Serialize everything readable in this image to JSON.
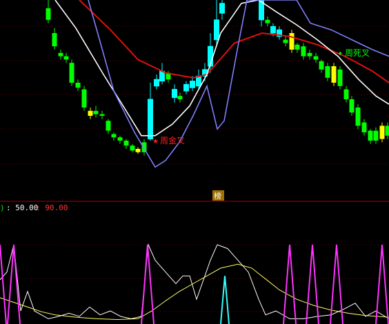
{
  "colors": {
    "background": "#000000",
    "grid": "#7a0000",
    "up_candle": "#00ffff",
    "down_candle": "#00ff00",
    "highlight_candle": "#ffff00",
    "ma_red": "#e01010",
    "ma_white": "#ffffff",
    "ma_blue": "#8080ff",
    "osc_white": "#ffffff",
    "osc_yellow": "#ffff66",
    "osc_magenta": "#ff33ff",
    "osc_cyan": "#33ffff",
    "label_value_a": "#ffffff",
    "label_value_b": "#ff3333",
    "golden_cross": "#ff2020",
    "death_cross": "#00ff00",
    "badge_bg": "#a07000"
  },
  "indicator_header": {
    "prefix": ")",
    "value_a": ": 50.00",
    "value_b": ": 90.00"
  },
  "divider_badge": "榜",
  "chart_data": [
    {
      "type": "candlestick",
      "ylim": [
        0,
        100
      ],
      "candles": [
        {
          "x": 70,
          "o": 95,
          "c": 88,
          "h": 100,
          "l": 86,
          "kind": "down"
        },
        {
          "x": 79,
          "o": 80,
          "c": 72,
          "h": 83,
          "l": 70,
          "kind": "down"
        },
        {
          "x": 88,
          "o": 68,
          "c": 66,
          "h": 70,
          "l": 64,
          "kind": "down"
        },
        {
          "x": 96,
          "o": 66,
          "c": 64,
          "h": 68,
          "l": 62,
          "kind": "down"
        },
        {
          "x": 104,
          "o": 62,
          "c": 50,
          "h": 64,
          "l": 48,
          "kind": "down"
        },
        {
          "x": 113,
          "o": 50,
          "c": 47,
          "h": 52,
          "l": 45,
          "kind": "down"
        },
        {
          "x": 122,
          "o": 46,
          "c": 35,
          "h": 48,
          "l": 33,
          "kind": "down"
        },
        {
          "x": 131,
          "o": 33,
          "c": 30,
          "h": 35,
          "l": 28,
          "kind": "highlight"
        },
        {
          "x": 139,
          "o": 33,
          "c": 31,
          "h": 36,
          "l": 29,
          "kind": "down"
        },
        {
          "x": 148,
          "o": 31,
          "c": 30,
          "h": 33,
          "l": 28,
          "kind": "down"
        },
        {
          "x": 157,
          "o": 27,
          "c": 21,
          "h": 28,
          "l": 19,
          "kind": "down"
        },
        {
          "x": 165,
          "o": 19,
          "c": 17,
          "h": 20,
          "l": 15,
          "kind": "down"
        },
        {
          "x": 174,
          "o": 17,
          "c": 15,
          "h": 18,
          "l": 13,
          "kind": "down"
        },
        {
          "x": 183,
          "o": 15,
          "c": 12,
          "h": 16,
          "l": 10,
          "kind": "down"
        },
        {
          "x": 192,
          "o": 12,
          "c": 9,
          "h": 13,
          "l": 8,
          "kind": "down"
        },
        {
          "x": 200,
          "o": 10,
          "c": 8,
          "h": 11,
          "l": 7,
          "kind": "highlight"
        },
        {
          "x": 209,
          "o": 14,
          "c": 8,
          "h": 16,
          "l": 6,
          "kind": "down"
        },
        {
          "x": 218,
          "o": 16,
          "c": 40,
          "h": 50,
          "l": 15,
          "kind": "up"
        },
        {
          "x": 227,
          "o": 48,
          "c": 52,
          "h": 55,
          "l": 46,
          "kind": "up"
        },
        {
          "x": 235,
          "o": 51,
          "c": 57,
          "h": 62,
          "l": 49,
          "kind": "up"
        },
        {
          "x": 244,
          "o": 56,
          "c": 52,
          "h": 57,
          "l": 50,
          "kind": "down"
        },
        {
          "x": 253,
          "o": 41,
          "c": 46,
          "h": 49,
          "l": 38,
          "kind": "up"
        },
        {
          "x": 261,
          "o": 42,
          "c": 40,
          "h": 44,
          "l": 38,
          "kind": "down"
        },
        {
          "x": 270,
          "o": 45,
          "c": 49,
          "h": 51,
          "l": 43,
          "kind": "up"
        },
        {
          "x": 279,
          "o": 47,
          "c": 51,
          "h": 54,
          "l": 45,
          "kind": "up"
        },
        {
          "x": 288,
          "o": 48,
          "c": 54,
          "h": 58,
          "l": 46,
          "kind": "up"
        },
        {
          "x": 297,
          "o": 54,
          "c": 58,
          "h": 62,
          "l": 51,
          "kind": "up"
        },
        {
          "x": 305,
          "o": 60,
          "c": 72,
          "h": 80,
          "l": 56,
          "kind": "up"
        },
        {
          "x": 314,
          "o": 76,
          "c": 88,
          "h": 100,
          "l": 72,
          "kind": "up"
        },
        {
          "x": 322,
          "o": 92,
          "c": 98,
          "h": 100,
          "l": 88,
          "kind": "up"
        },
        {
          "x": 379,
          "o": 100,
          "c": 88,
          "h": 100,
          "l": 84,
          "kind": "up"
        },
        {
          "x": 388,
          "o": 88,
          "c": 86,
          "h": 90,
          "l": 84,
          "kind": "down"
        },
        {
          "x": 396,
          "o": 84,
          "c": 80,
          "h": 86,
          "l": 78,
          "kind": "up"
        },
        {
          "x": 405,
          "o": 82,
          "c": 78,
          "h": 84,
          "l": 76,
          "kind": "up"
        },
        {
          "x": 414,
          "o": 76,
          "c": 74,
          "h": 78,
          "l": 72,
          "kind": "down"
        },
        {
          "x": 423,
          "o": 80,
          "c": 70,
          "h": 82,
          "l": 68,
          "kind": "highlight"
        },
        {
          "x": 431,
          "o": 73,
          "c": 70,
          "h": 74,
          "l": 68,
          "kind": "down"
        },
        {
          "x": 440,
          "o": 72,
          "c": 66,
          "h": 74,
          "l": 64,
          "kind": "down"
        },
        {
          "x": 449,
          "o": 68,
          "c": 66,
          "h": 70,
          "l": 64,
          "kind": "down"
        },
        {
          "x": 458,
          "o": 66,
          "c": 64,
          "h": 68,
          "l": 62,
          "kind": "down"
        },
        {
          "x": 466,
          "o": 63,
          "c": 58,
          "h": 64,
          "l": 56,
          "kind": "down"
        },
        {
          "x": 475,
          "o": 60,
          "c": 53,
          "h": 62,
          "l": 51,
          "kind": "down"
        },
        {
          "x": 484,
          "o": 60,
          "c": 50,
          "h": 62,
          "l": 48,
          "kind": "highlight"
        },
        {
          "x": 493,
          "o": 58,
          "c": 48,
          "h": 60,
          "l": 46,
          "kind": "down"
        },
        {
          "x": 502,
          "o": 46,
          "c": 40,
          "h": 48,
          "l": 38,
          "kind": "down"
        },
        {
          "x": 510,
          "o": 40,
          "c": 32,
          "h": 42,
          "l": 30,
          "kind": "down"
        },
        {
          "x": 519,
          "o": 35,
          "c": 24,
          "h": 37,
          "l": 22,
          "kind": "down"
        },
        {
          "x": 528,
          "o": 26,
          "c": 20,
          "h": 28,
          "l": 18,
          "kind": "down"
        },
        {
          "x": 537,
          "o": 21,
          "c": 15,
          "h": 22,
          "l": 13,
          "kind": "down"
        },
        {
          "x": 545,
          "o": 21,
          "c": 15,
          "h": 23,
          "l": 13,
          "kind": "down"
        },
        {
          "x": 554,
          "o": 24,
          "c": 16,
          "h": 26,
          "l": 14,
          "kind": "highlight"
        },
        {
          "x": 562,
          "o": 24,
          "c": 18,
          "h": 26,
          "l": 16,
          "kind": "down"
        }
      ],
      "lines": [
        {
          "name": "ma-red",
          "color": "#e01010",
          "points": [
            [
              115,
              100
            ],
            [
              160,
              82
            ],
            [
              200,
              64
            ],
            [
              240,
              56
            ],
            [
              280,
              53
            ],
            [
              300,
              55
            ],
            [
              340,
              74
            ],
            [
              380,
              80
            ],
            [
              420,
              78
            ],
            [
              460,
              73
            ],
            [
              500,
              66
            ],
            [
              540,
              57
            ],
            [
              564,
              50
            ]
          ]
        },
        {
          "name": "ma-white",
          "color": "#ffffff",
          "points": [
            [
              80,
              100
            ],
            [
              110,
              83
            ],
            [
              150,
              55
            ],
            [
              180,
              35
            ],
            [
              205,
              18
            ],
            [
              225,
              18
            ],
            [
              250,
              25
            ],
            [
              275,
              36
            ],
            [
              300,
              55
            ],
            [
              320,
              80
            ],
            [
              350,
              98
            ],
            [
              375,
              100
            ],
            [
              400,
              93
            ],
            [
              430,
              85
            ],
            [
              460,
              76
            ],
            [
              490,
              66
            ],
            [
              520,
              52
            ],
            [
              545,
              42
            ],
            [
              564,
              37
            ]
          ]
        },
        {
          "name": "ma-blue",
          "color": "#8080ff",
          "points": [
            [
              128,
              100
            ],
            [
              145,
              75
            ],
            [
              165,
              45
            ],
            [
              195,
              20
            ],
            [
              225,
              -1
            ],
            [
              240,
              3
            ],
            [
              260,
              14
            ],
            [
              280,
              30
            ],
            [
              300,
              48
            ],
            [
              315,
              22
            ],
            [
              325,
              27
            ],
            [
              345,
              72
            ],
            [
              358,
              100
            ],
            [
              430,
              100
            ],
            [
              450,
              86
            ],
            [
              480,
              82
            ],
            [
              510,
              76
            ],
            [
              540,
              70
            ],
            [
              564,
              66
            ]
          ]
        }
      ],
      "annotations": [
        {
          "text": "周金叉",
          "color": "#ff2020",
          "x": 232,
          "y": 15,
          "arrow": "★"
        },
        {
          "text": "周死叉",
          "color": "#00ff00",
          "x": 500,
          "y": 68,
          "arrow": "✦"
        }
      ]
    },
    {
      "type": "line",
      "ylim": [
        0,
        100
      ],
      "series": [
        {
          "name": "osc-white",
          "color": "#ffffff",
          "points": [
            [
              0,
              45
            ],
            [
              10,
              35
            ],
            [
              20,
              0
            ],
            [
              30,
              85
            ],
            [
              40,
              60
            ],
            [
              50,
              85
            ],
            [
              60,
              90
            ],
            [
              70,
              95
            ],
            [
              85,
              92
            ],
            [
              100,
              88
            ],
            [
              115,
              92
            ],
            [
              130,
              80
            ],
            [
              145,
              90
            ],
            [
              160,
              85
            ],
            [
              175,
              92
            ],
            [
              190,
              95
            ],
            [
              205,
              92
            ],
            [
              215,
              0
            ],
            [
              225,
              20
            ],
            [
              240,
              35
            ],
            [
              255,
              50
            ],
            [
              265,
              40
            ],
            [
              275,
              40
            ],
            [
              285,
              70
            ],
            [
              295,
              45
            ],
            [
              305,
              20
            ],
            [
              315,
              0
            ],
            [
              330,
              5
            ],
            [
              345,
              20
            ],
            [
              360,
              35
            ],
            [
              375,
              70
            ],
            [
              385,
              90
            ],
            [
              400,
              85
            ],
            [
              420,
              95
            ],
            [
              440,
              95
            ],
            [
              460,
              92
            ],
            [
              480,
              90
            ],
            [
              500,
              82
            ],
            [
              515,
              75
            ],
            [
              530,
              92
            ],
            [
              545,
              85
            ],
            [
              564,
              95
            ]
          ]
        },
        {
          "name": "osc-yellow",
          "color": "#ffff66",
          "points": [
            [
              0,
              68
            ],
            [
              20,
              74
            ],
            [
              40,
              80
            ],
            [
              60,
              86
            ],
            [
              80,
              90
            ],
            [
              110,
              93
            ],
            [
              140,
              95
            ],
            [
              170,
              96
            ],
            [
              200,
              95
            ],
            [
              220,
              85
            ],
            [
              240,
              72
            ],
            [
              260,
              60
            ],
            [
              280,
              50
            ],
            [
              300,
              40
            ],
            [
              320,
              30
            ],
            [
              345,
              25
            ],
            [
              365,
              30
            ],
            [
              385,
              44
            ],
            [
              405,
              58
            ],
            [
              430,
              70
            ],
            [
              455,
              78
            ],
            [
              480,
              84
            ],
            [
              505,
              88
            ],
            [
              530,
              91
            ],
            [
              564,
              93
            ]
          ]
        },
        {
          "name": "osc-magenta",
          "color": "#ff33ff",
          "spikes": [
            [
              0,
              0
            ],
            [
              20,
              0
            ],
            [
              214,
              0
            ],
            [
              420,
              0
            ],
            [
              453,
              0
            ],
            [
              488,
              0
            ],
            [
              554,
              0
            ]
          ]
        },
        {
          "name": "osc-cyan",
          "color": "#33ffff",
          "spikes": [
            [
              326,
              40
            ]
          ]
        }
      ]
    }
  ]
}
